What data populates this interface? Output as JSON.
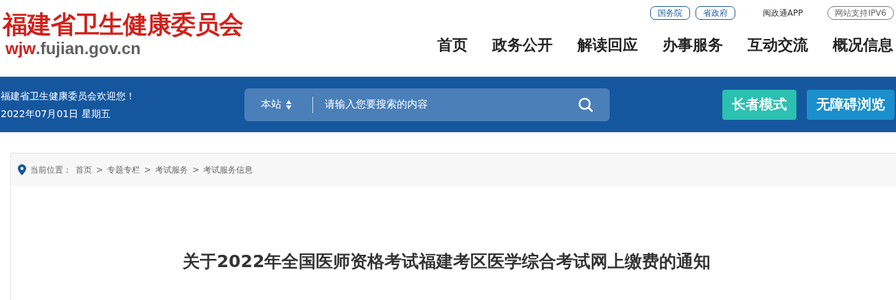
{
  "header": {
    "site_name": "福建省卫生健康委员会",
    "domain_prefix": "wjw",
    "domain_rest": ".fujian.gov.cn",
    "top_links": [
      {
        "label": "国务院",
        "kind": "outlined"
      },
      {
        "label": "省政府",
        "kind": "outlined"
      },
      {
        "label": "闽政通APP",
        "kind": "plain"
      },
      {
        "label": "网站支持IPV6",
        "kind": "grey"
      }
    ],
    "nav": [
      "首页",
      "政务公开",
      "解读回应",
      "办事服务",
      "互动交流",
      "概况信息"
    ]
  },
  "banner": {
    "welcome": "福建省卫生健康委员会欢迎您！",
    "date": "2022年07月01日 星期五",
    "search": {
      "scope": "本站",
      "placeholder": "请输入您要搜索的内容"
    },
    "buttons": [
      {
        "label": "长者模式",
        "color": "#2bc0b0"
      },
      {
        "label": "无障碍浏览",
        "color": "#1a8fcc"
      }
    ]
  },
  "breadcrumb": {
    "label": "当前位置：",
    "separator": ">",
    "items": [
      "首页",
      "专题专栏",
      "考试服务",
      "考试服务信息"
    ]
  },
  "article": {
    "title": "关于2022年全国医师资格考试福建考区医学综合考试网上缴费的通知"
  }
}
